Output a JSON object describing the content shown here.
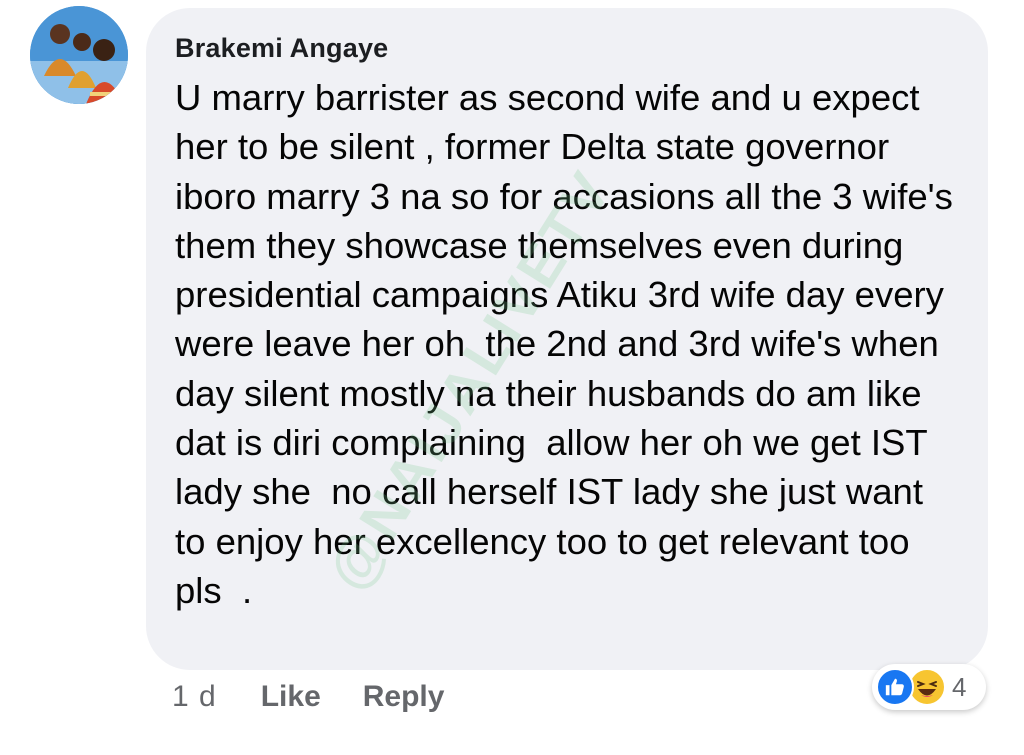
{
  "comment": {
    "author": "Brakemi Angaye",
    "text": "U marry barrister as second wife and u expect her to be silent , former Delta state governor iboro marry 3 na so for accasions all the 3 wife's them they showcase themselves even during presidential campaigns Atiku 3rd wife day every were leave her oh  the 2nd and 3rd wife's when day silent mostly na their husbands do am like dat is diri complaining  allow her oh we get IST lady she  no call herself IST lady she just want  to enjoy her excellency too to get relevant too pls  .",
    "watermark": "@NAIJALIVETV"
  },
  "actions": {
    "time": "1 d",
    "like_label": "Like",
    "reply_label": "Reply"
  },
  "reactions": {
    "icons": [
      "like-icon",
      "haha-icon"
    ],
    "count": "4",
    "like_color": "#1877f2",
    "haha_color": "#f7c531"
  },
  "colors": {
    "bubble": "#f0f1f5",
    "secondary_text": "#65676b"
  }
}
